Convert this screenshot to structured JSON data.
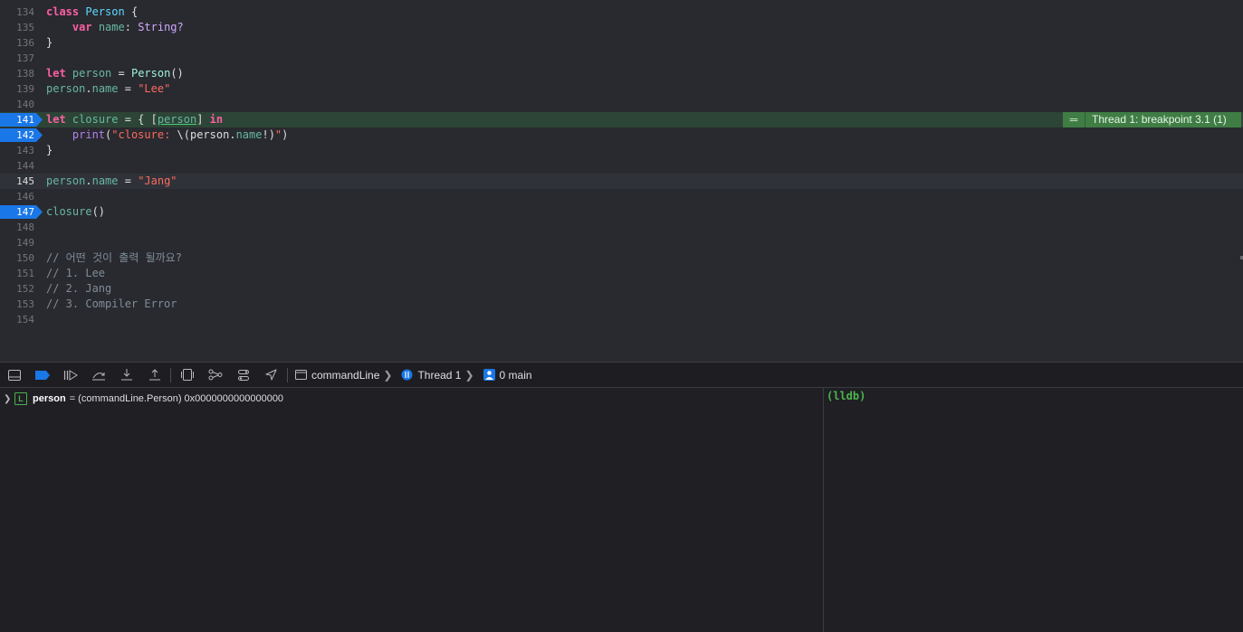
{
  "editor": {
    "line_numbers": [
      "134",
      "135",
      "136",
      "137",
      "138",
      "139",
      "140",
      "141",
      "142",
      "143",
      "144",
      "145",
      "146",
      "147",
      "148",
      "149",
      "150",
      "151",
      "152",
      "153",
      "154"
    ],
    "tokens": {
      "class_kw": "class",
      "person_class": "Person",
      "open_brace": " {",
      "var_kw": "var",
      "name_prop": "name",
      "colon": ": ",
      "string_type": "String?",
      "close_brace": "}",
      "let_kw": "let",
      "person_var": "person",
      "eq": " = ",
      "person_ctor": "Person",
      "parens": "()",
      "dot": ".",
      "lee_str": "\"Lee\"",
      "closure_var": "closure",
      "eq_brace_bracket": " = { [",
      "capture_person": "person",
      "bracket_close": "] ",
      "in_kw": "in",
      "print_fn": "print",
      "open_paren": "(",
      "print_str_a": "\"closure: ",
      "interp_open": "\\(",
      "print_person": "person",
      "print_name": "name",
      "interp_close": "!)",
      "print_str_b": "\"",
      "close_paren": ")",
      "jang_str": "\"Jang\"",
      "closure_call": "closure",
      "comment_question": "// 어떤 것이 출력 될까요?",
      "comment_1": "// 1. Lee",
      "comment_2": "// 2. Jang",
      "comment_3": "// 3. Compiler Error"
    },
    "annotation": {
      "text": "Thread 1: breakpoint 3.1 (1)"
    }
  },
  "debugbar": {
    "icons": [
      "toggle-debug-area-icon",
      "breakpoints-active-icon",
      "continue-icon",
      "step-over-icon",
      "step-into-icon",
      "step-out-icon",
      "debug-view-hierarchy-icon",
      "memory-graph-icon",
      "environment-overrides-icon",
      "simulate-location-icon"
    ],
    "breadcrumb": {
      "target": "commandLine",
      "thread": "Thread 1",
      "frame": "0 main"
    }
  },
  "variables": {
    "badge": "L",
    "name": "person",
    "value": "= (commandLine.Person) 0x0000000000000000"
  },
  "console": {
    "prompt": "(lldb)"
  },
  "colors": {
    "breakpoint": "#1a77e8",
    "annotation": "#3f7d45",
    "keyword": "#fc5fa3",
    "string": "#fc6a5d"
  }
}
